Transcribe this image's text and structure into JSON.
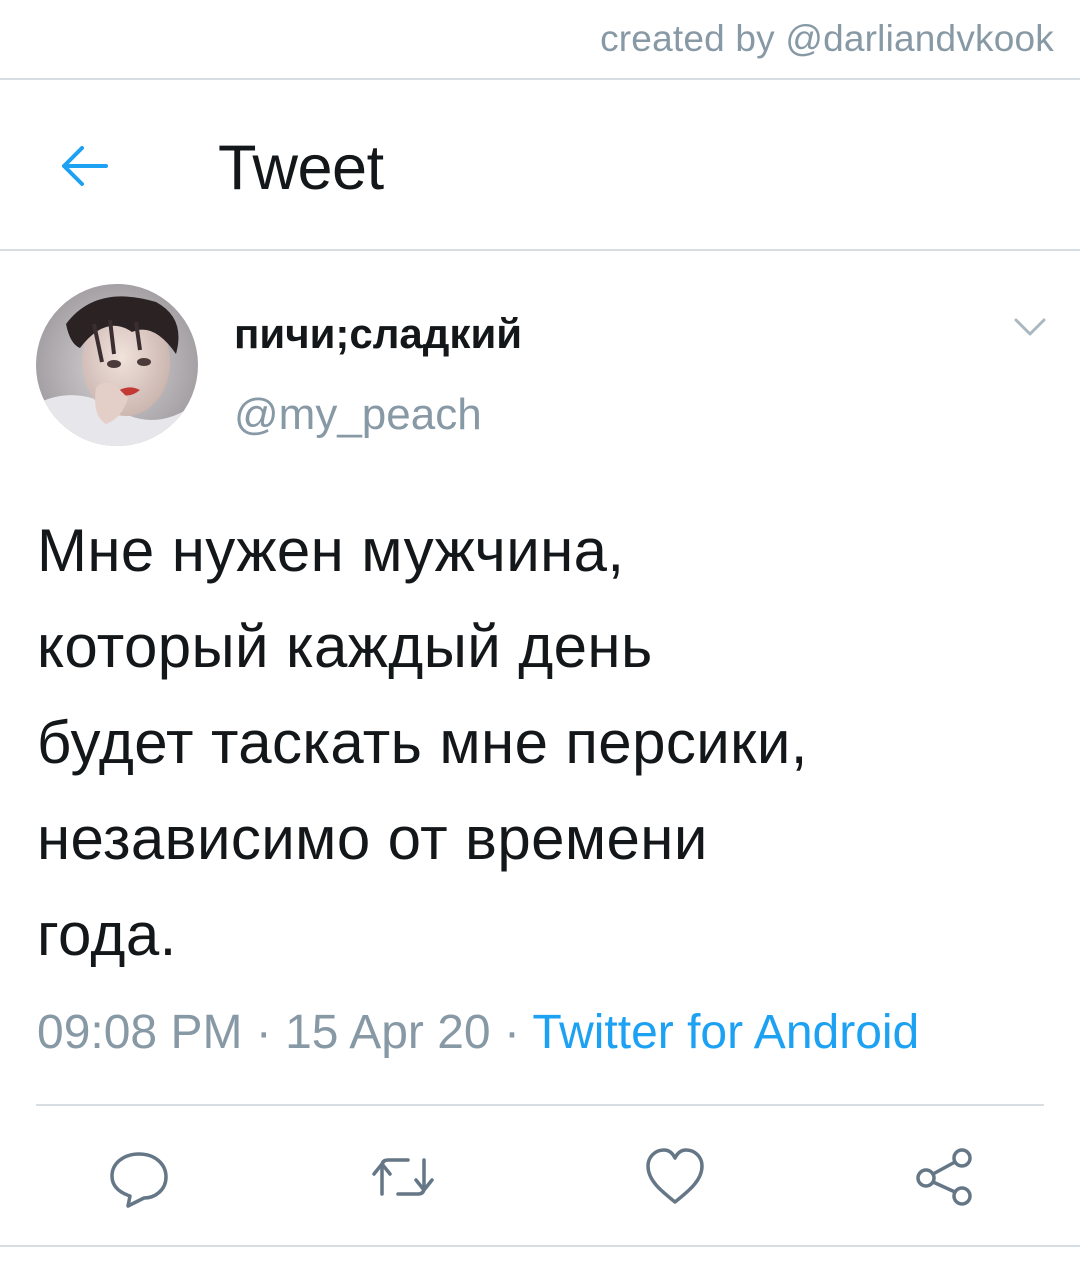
{
  "credit": "created by @darliandvkook",
  "header": {
    "title": "Tweet",
    "back_icon": "arrow-left-icon",
    "accent_color": "#1da1f2"
  },
  "tweet": {
    "display_name": "пичи;сладкий",
    "handle": "@my_peach",
    "text_lines": [
      "Мне нужен мужчина,",
      "который каждый день",
      "будет таскать мне персики,",
      "независимо от времени",
      "года."
    ],
    "time": "09:08 PM",
    "date": "15 Apr 20",
    "separator": " · ",
    "source": "Twitter for Android"
  },
  "actions": [
    {
      "name": "reply",
      "icon": "reply-icon"
    },
    {
      "name": "retweet",
      "icon": "retweet-icon"
    },
    {
      "name": "like",
      "icon": "heart-icon"
    },
    {
      "name": "share",
      "icon": "share-icon"
    }
  ],
  "colors": {
    "text": "#14171a",
    "muted": "#8899a6",
    "link": "#1da1f2",
    "divider": "#d6dde3"
  }
}
